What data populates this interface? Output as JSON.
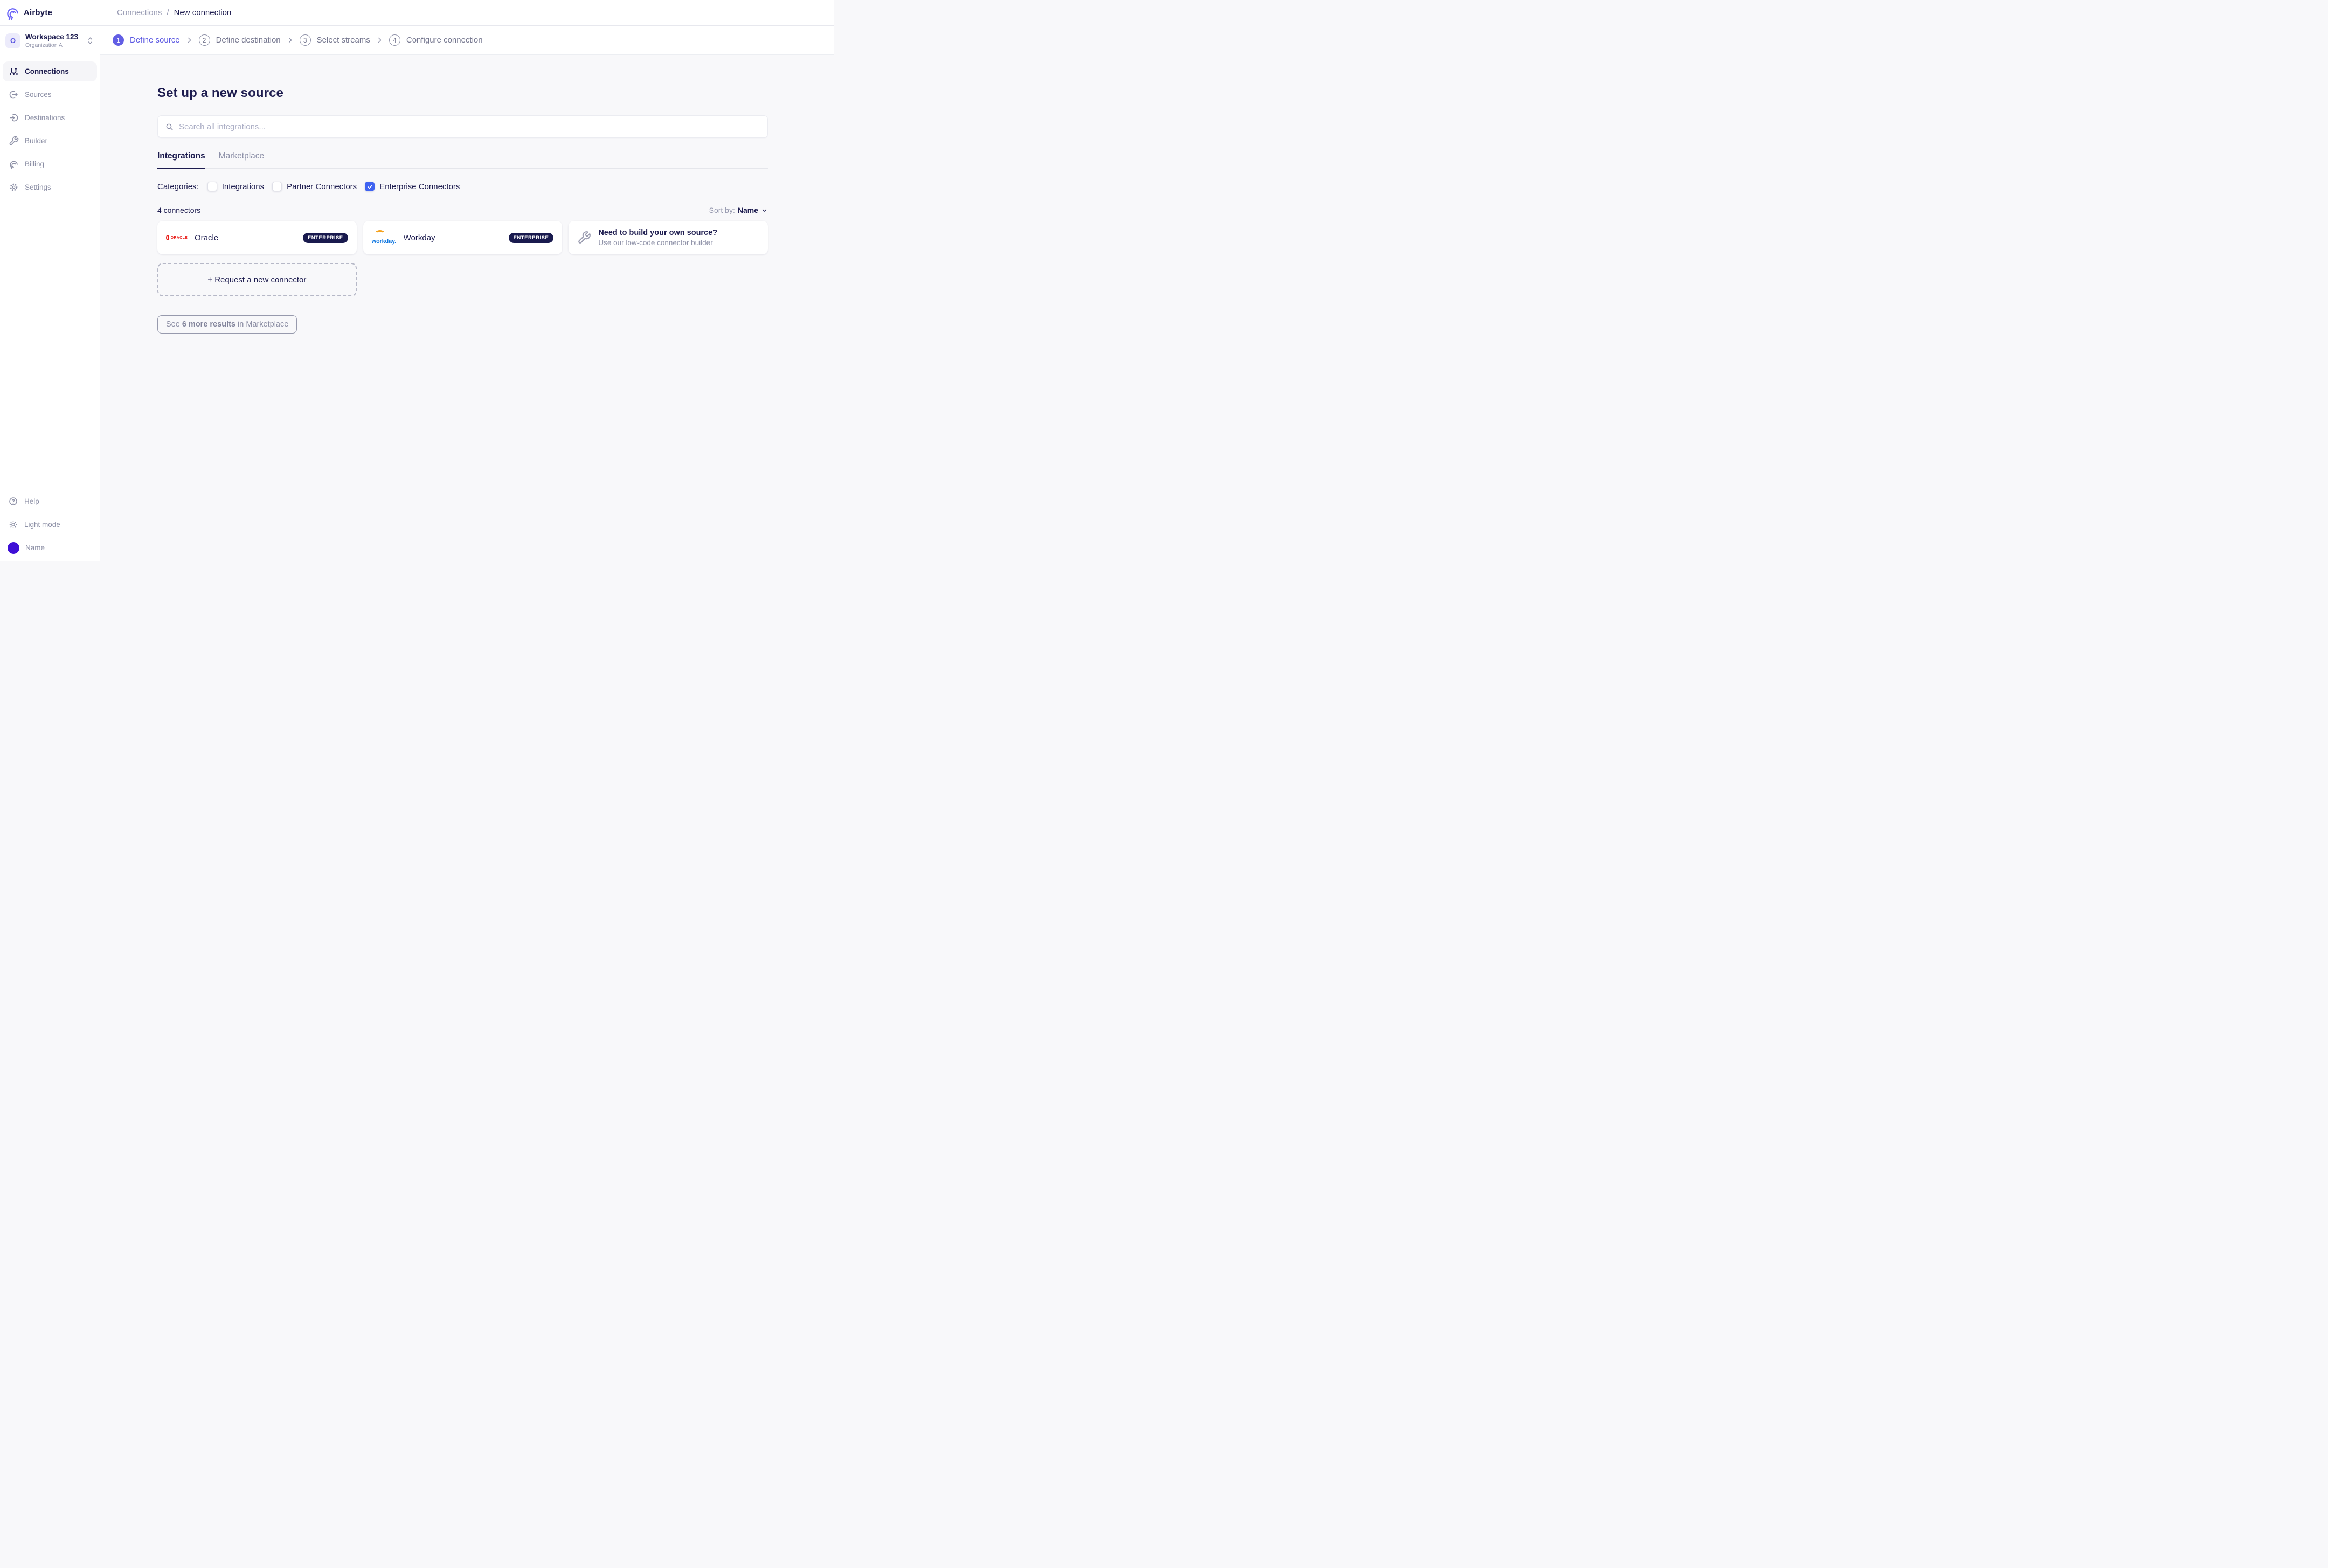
{
  "brand": {
    "name": "Airbyte"
  },
  "workspace": {
    "initial": "O",
    "name": "Workspace 123",
    "org": "Organization A"
  },
  "sidebar": {
    "items": [
      {
        "label": "Connections",
        "icon": "connections-icon",
        "active": true
      },
      {
        "label": "Sources",
        "icon": "sources-icon",
        "active": false
      },
      {
        "label": "Destinations",
        "icon": "destinations-icon",
        "active": false
      },
      {
        "label": "Builder",
        "icon": "builder-icon",
        "active": false
      },
      {
        "label": "Billing",
        "icon": "billing-icon",
        "active": false
      },
      {
        "label": "Settings",
        "icon": "settings-icon",
        "active": false
      }
    ],
    "footer": [
      {
        "label": "Help",
        "icon": "help-icon"
      },
      {
        "label": "Light mode",
        "icon": "sun-icon"
      },
      {
        "label": "Name",
        "icon": "avatar"
      }
    ]
  },
  "breadcrumb": {
    "parent": "Connections",
    "separator": "/",
    "current": "New connection"
  },
  "stepper": [
    {
      "num": "1",
      "label": "Define source",
      "active": true
    },
    {
      "num": "2",
      "label": "Define destination",
      "active": false
    },
    {
      "num": "3",
      "label": "Select streams",
      "active": false
    },
    {
      "num": "4",
      "label": "Configure connection",
      "active": false
    }
  ],
  "main": {
    "title": "Set up a new source",
    "search_placeholder": "Search all integrations...",
    "tabs": [
      {
        "label": "Integrations",
        "active": true
      },
      {
        "label": "Marketplace",
        "active": false
      }
    ],
    "categories": {
      "label": "Categories:",
      "options": [
        {
          "label": "Integrations",
          "checked": false
        },
        {
          "label": "Partner Connectors",
          "checked": false
        },
        {
          "label": "Enterprise Connectors",
          "checked": true
        }
      ]
    },
    "results": {
      "count": "4 connectors",
      "sort_label": "Sort by:",
      "sort_value": "Name"
    },
    "connectors": [
      {
        "name": "Oracle",
        "badge": "ENTERPRISE",
        "logo_text": "ORACLE"
      },
      {
        "name": "Workday",
        "badge": "ENTERPRISE",
        "logo_text": "workday."
      }
    ],
    "builder_card": {
      "title": "Need to build your own source?",
      "subtitle": "Use our low-code connector builder"
    },
    "request_label": "+ Request a new connector",
    "see_more": {
      "prefix": "See ",
      "bold": "6 more results",
      "suffix": " in Marketplace"
    }
  },
  "colors": {
    "primary_indigo": "#615ee4",
    "checkbox_blue": "#3f63f1",
    "navy": "#1d1c4f",
    "enterprise_badge_bg": "#191a4e",
    "avatar": "#3e0fd6",
    "oracle_red": "#e9201c",
    "workday_blue": "#0e76e0",
    "workday_orange": "#f5a21d",
    "page_bg": "#f8f8fa"
  }
}
